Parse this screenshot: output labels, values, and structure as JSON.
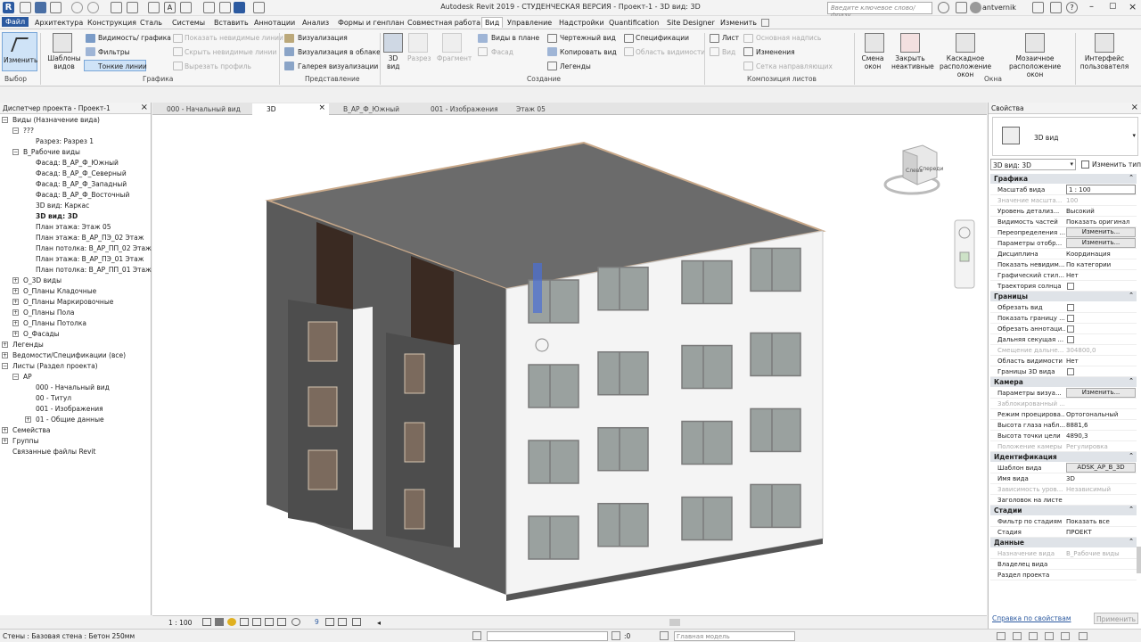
{
  "app": {
    "title": "Autodesk Revit 2019 - СТУДЕНЧЕСКАЯ ВЕРСИЯ - Проект-1 - 3D вид: 3D",
    "search_placeholder": "Введите ключевое слово/фразу",
    "user": "antvernik",
    "accent": "#2c5aa0"
  },
  "menu": [
    "Файл",
    "Архитектура",
    "Конструкция",
    "Сталь",
    "Системы",
    "Вставить",
    "Аннотации",
    "Анализ",
    "Формы и генплан",
    "Совместная работа",
    "Вид",
    "Управление",
    "Надстройки",
    "Quantification",
    "Site Designer",
    "Изменить"
  ],
  "ribbon": {
    "select": {
      "modify": "Изменить",
      "select": "Выбор"
    },
    "graphics": {
      "templates": "Шаблоны видов",
      "visibility": "Видимость/ графика",
      "filters": "Фильтры",
      "thin_lines": "Тонкие линии",
      "show_hidden": "Показать невидимые линии",
      "hide_hidden": "Скрыть невидимые линии",
      "cut_profile": "Вырезать профиль",
      "group": "Графика"
    },
    "presentation": {
      "render": "Визуализация",
      "render_cloud": "Визуализация в облаке",
      "gallery": "Галерея визуализации",
      "group": "Представление"
    },
    "create": {
      "view3d": "3D вид",
      "section": "Разрез",
      "callout": "Фрагмент",
      "plan_views": "Виды в плане",
      "elevation": "Фасад",
      "drafting": "Чертежный вид",
      "duplicate": "Копировать вид",
      "legends": "Легенды",
      "schedules": "Спецификации",
      "scope": "Область видимости",
      "group": "Создание"
    },
    "sheets": {
      "sheet": "Лист",
      "view": "Вид",
      "title_block": "Основная надпись",
      "revisions": "Изменения",
      "guide_grid": "Сетка направляющих",
      "group": "Композиция листов"
    },
    "windows": {
      "switch": "Смена окон",
      "close_inactive": "Закрыть неактивные",
      "cascade": "Каскадное расположение окон",
      "tile": "Мозаичное расположение окон",
      "ui": "Интерфейс пользователя",
      "group": "Окна"
    }
  },
  "browser": {
    "title": "Диспетчер проекта - Проект-1",
    "items": [
      {
        "label": "Виды (Назначение вида)",
        "level": 0,
        "toggle": "−"
      },
      {
        "label": "???",
        "level": 1,
        "toggle": "−"
      },
      {
        "label": "Разрез: Разрез 1",
        "level": 2,
        "toggle": ""
      },
      {
        "label": "В_Рабочие виды",
        "level": 1,
        "toggle": "−"
      },
      {
        "label": "Фасад: В_АР_Ф_Южный",
        "level": 2,
        "toggle": ""
      },
      {
        "label": "Фасад: В_АР_Ф_Северный",
        "level": 2,
        "toggle": ""
      },
      {
        "label": "Фасад: В_АР_Ф_Западный",
        "level": 2,
        "toggle": ""
      },
      {
        "label": "Фасад: В_АР_Ф_Восточный",
        "level": 2,
        "toggle": ""
      },
      {
        "label": "3D вид: Каркас",
        "level": 2,
        "toggle": ""
      },
      {
        "label": "3D вид: 3D",
        "level": 2,
        "toggle": "",
        "bold": true
      },
      {
        "label": "План этажа: Этаж 05",
        "level": 2,
        "toggle": ""
      },
      {
        "label": "План этажа: В_АР_ПЭ_02 Этаж",
        "level": 2,
        "toggle": ""
      },
      {
        "label": "План потолка: В_АР_ПП_02 Этаж",
        "level": 2,
        "toggle": ""
      },
      {
        "label": "План этажа: В_АР_ПЭ_01 Этаж",
        "level": 2,
        "toggle": ""
      },
      {
        "label": "План потолка: В_АР_ПП_01 Этаж",
        "level": 2,
        "toggle": ""
      },
      {
        "label": "О_3D виды",
        "level": 1,
        "toggle": "+"
      },
      {
        "label": "О_Планы Кладочные",
        "level": 1,
        "toggle": "+"
      },
      {
        "label": "О_Планы Маркировочные",
        "level": 1,
        "toggle": "+"
      },
      {
        "label": "О_Планы Пола",
        "level": 1,
        "toggle": "+"
      },
      {
        "label": "О_Планы Потолка",
        "level": 1,
        "toggle": "+"
      },
      {
        "label": "О_Фасады",
        "level": 1,
        "toggle": "+"
      },
      {
        "label": "Легенды",
        "level": 0,
        "toggle": "+"
      },
      {
        "label": "Ведомости/Спецификации (все)",
        "level": 0,
        "toggle": "+"
      },
      {
        "label": "Листы (Раздел проекта)",
        "level": 0,
        "toggle": "−"
      },
      {
        "label": "АР",
        "level": 1,
        "toggle": "−"
      },
      {
        "label": "000 - Начальный вид",
        "level": 2,
        "toggle": ""
      },
      {
        "label": "00 - Титул",
        "level": 2,
        "toggle": ""
      },
      {
        "label": "001 - Изображения",
        "level": 2,
        "toggle": ""
      },
      {
        "label": "01 - Общие данные",
        "level": 2,
        "toggle": "+"
      },
      {
        "label": "Семейства",
        "level": 0,
        "toggle": "+"
      },
      {
        "label": "Группы",
        "level": 0,
        "toggle": "+"
      },
      {
        "label": "Связанные файлы Revit",
        "level": 0,
        "toggle": ""
      }
    ]
  },
  "tabs": [
    "000 - Начальный вид",
    "3D",
    "В_АР_Ф_Южный",
    "001 - Изображения",
    "Этаж 05"
  ],
  "viewcube": {
    "left": "Слева",
    "front": "Спереди"
  },
  "viewbar": {
    "scale": "1 : 100",
    "counter": "9"
  },
  "properties": {
    "title": "Свойства",
    "type_name": "3D вид",
    "selector": "3D вид: 3D",
    "edit_type": "Изменить тип",
    "help": "Справка по свойствам",
    "apply": "Применить",
    "sections": [
      {
        "name": "Графика",
        "rows": [
          {
            "k": "Масштаб вида",
            "v": "1 : 100",
            "kind": "input"
          },
          {
            "k": "Значение масшта...",
            "v": "100",
            "dim": true
          },
          {
            "k": "Уровень детализ...",
            "v": "Высокий"
          },
          {
            "k": "Видимость частей",
            "v": "Показать оригинал"
          },
          {
            "k": "Переопределения ...",
            "v": "Изменить...",
            "kind": "button"
          },
          {
            "k": "Параметры отобр...",
            "v": "Изменить...",
            "kind": "button"
          },
          {
            "k": "Дисциплина",
            "v": "Координация"
          },
          {
            "k": "Показать невидим...",
            "v": "По категории"
          },
          {
            "k": "Графический стил...",
            "v": "Нет"
          },
          {
            "k": "Траектория солнца",
            "v": "",
            "kind": "check"
          }
        ]
      },
      {
        "name": "Границы",
        "rows": [
          {
            "k": "Обрезать вид",
            "v": "",
            "kind": "check"
          },
          {
            "k": "Показать границу ...",
            "v": "",
            "kind": "check"
          },
          {
            "k": "Обрезать аннотаци...",
            "v": "",
            "kind": "check"
          },
          {
            "k": "Дальняя секущая ...",
            "v": "",
            "kind": "check"
          },
          {
            "k": "Смещение дальне...",
            "v": "304800,0",
            "dim": true
          },
          {
            "k": "Область видимости",
            "v": "Нет"
          },
          {
            "k": "Границы 3D вида",
            "v": "",
            "kind": "check"
          }
        ]
      },
      {
        "name": "Камера",
        "rows": [
          {
            "k": "Параметры визуа...",
            "v": "Изменить...",
            "kind": "button"
          },
          {
            "k": "Заблокированный ...",
            "v": "",
            "dim": true
          },
          {
            "k": "Режим проецирова...",
            "v": "Ортогональный"
          },
          {
            "k": "Высота глаза набл...",
            "v": "8881,6"
          },
          {
            "k": "Высота точки цели",
            "v": "4890,3"
          },
          {
            "k": "Положение камеры",
            "v": "Регулировка",
            "dim": true
          }
        ]
      },
      {
        "name": "Идентификация",
        "rows": [
          {
            "k": "Шаблон вида",
            "v": "ADSK_АР_В_3D",
            "kind": "button"
          },
          {
            "k": "Имя вида",
            "v": "3D"
          },
          {
            "k": "Зависимость уров...",
            "v": "Независимый",
            "dim": true
          },
          {
            "k": "Заголовок на листе",
            "v": ""
          }
        ]
      },
      {
        "name": "Стадии",
        "rows": [
          {
            "k": "Фильтр по стадиям",
            "v": "Показать все"
          },
          {
            "k": "Стадия",
            "v": "ПРОЕКТ"
          }
        ]
      },
      {
        "name": "Данные",
        "rows": [
          {
            "k": "Назначение вида",
            "v": "В_Рабочие виды",
            "dim": true
          },
          {
            "k": "Владелец вида",
            "v": ""
          },
          {
            "k": "Раздел проекта",
            "v": ""
          }
        ]
      }
    ]
  },
  "status": {
    "text": "Стены : Базовая стена : Бетон 250мм",
    "workset": ":0",
    "model": "Главная модель"
  }
}
